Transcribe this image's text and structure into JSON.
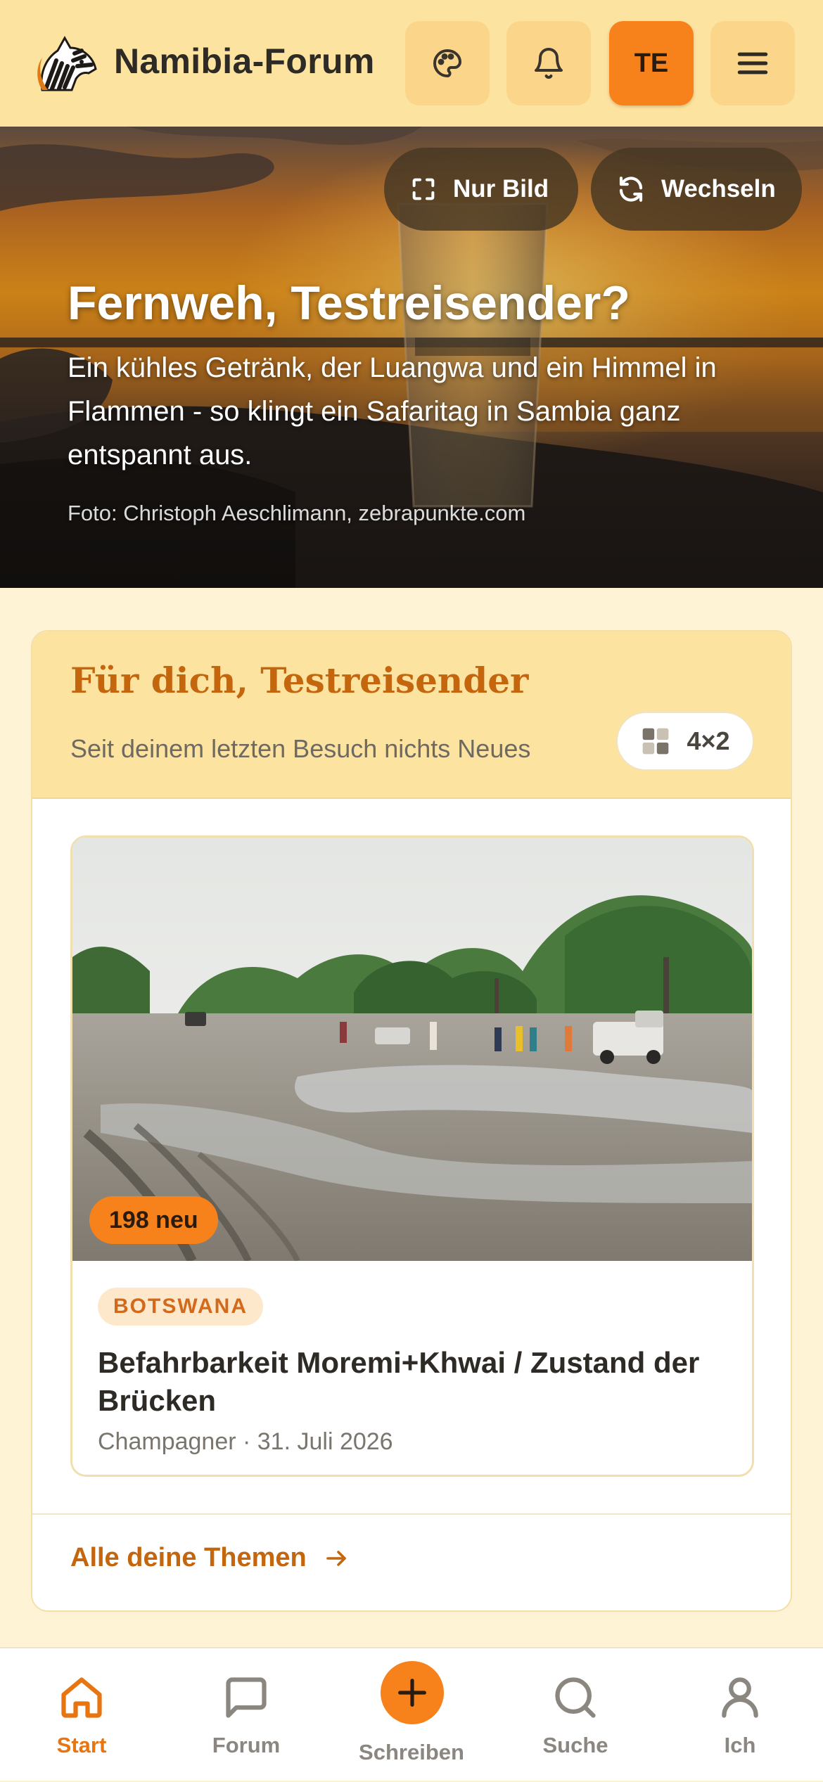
{
  "header": {
    "brand": "Namibia-Forum",
    "avatar_initials": "TE",
    "icons": [
      "zebra-logo",
      "palette-icon",
      "bell-icon",
      "menu-icon"
    ]
  },
  "hero": {
    "only_image_label": "Nur Bild",
    "switch_label": "Wechseln",
    "title": "Fernweh, Testreisender?",
    "subtitle": "Ein kühles Getränk, der Luangwa und ein Himmel in Flammen - so klingt ein Safaritag in Sambia ganz entspannt aus.",
    "credit": "Foto: Christoph Aeschlimann, zebrapunkte.com"
  },
  "for_you": {
    "title": "Für dich, Testreisender",
    "subtitle": "Seit deinem letzten Besuch nichts Neues",
    "grid_label": "4×2",
    "topic": {
      "new_count": "198 neu",
      "tag": "BOTSWANA",
      "title": "Befahrbarkeit Moremi+Khwai / Zustand der Brücken",
      "meta": "Champagner · 31. Juli 2026"
    },
    "all_topics_label": "Alle deine Themen"
  },
  "nav": {
    "items": [
      {
        "label": "Start",
        "icon": "home-icon",
        "active": true
      },
      {
        "label": "Forum",
        "icon": "chat-icon",
        "active": false
      },
      {
        "label": "Schreiben",
        "icon": "plus-icon",
        "active": false
      },
      {
        "label": "Suche",
        "icon": "search-icon",
        "active": false
      },
      {
        "label": "Ich",
        "icon": "user-icon",
        "active": false
      }
    ]
  },
  "colors": {
    "accent": "#f7821b",
    "accent_text": "#c4660e",
    "header_bg": "#fde3a0",
    "page_bg": "#fff3d6"
  }
}
